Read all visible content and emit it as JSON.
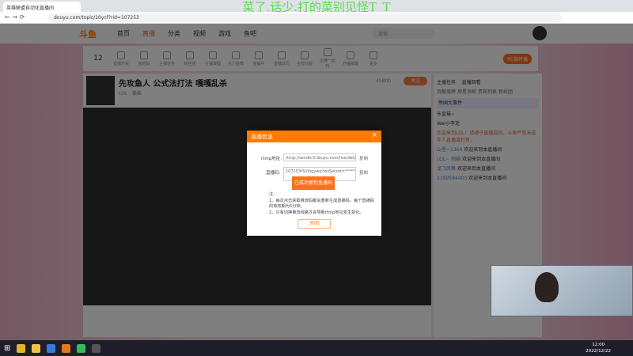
{
  "browser": {
    "tab_title": "英雄联盟自动化直播间",
    "url": "douyu.com/topic/10ycf?rid=107253",
    "overlay_title": "菜了.话少.打的菜别见怪T_T"
  },
  "nav": {
    "logo": "斗鱼",
    "items": [
      "首页",
      "直播",
      "分类",
      "视频",
      "游戏",
      "鱼吧"
    ],
    "active": 1,
    "search_placeholder": "搜索"
  },
  "subnav": {
    "level": "12",
    "items": [
      "直播开关",
      "鱼的码",
      "主播任务",
      "粉丝团",
      "主播课程",
      "大力金牌",
      "鱼抽中",
      "直播日历",
      "全部功能",
      "主播一起玩",
      "开播提醒",
      "更多"
    ],
    "pc_live": "PC端开播"
  },
  "room": {
    "title": "先攻鱼人 公式法打法 嘎嘎乱杀",
    "tag": "LOL · 猫猫",
    "follow": "关注",
    "follow_count": "45800"
  },
  "chat": {
    "tabs": [
      "主播任务",
      "直播回看"
    ],
    "subtabs": [
      "贡献周榜",
      "周星贡献",
      "贵宾列表",
      "粉丝团"
    ],
    "event": "帝国大事件",
    "ranks": [
      "东皇猫~",
      "Wei小李逝"
    ],
    "notice": "欢迎来到LOL！请遵守直播规则，斗鱼严禁未成年人直播或打赏。",
    "messages": [
      {
        "user": "山里~1364",
        "text": "欢迎来到本直播间"
      },
      {
        "user": "LOL~ 雨猫",
        "text": "欢迎来到本直播间"
      },
      {
        "user": "龙飞凤舞",
        "text": "欢迎来到本直播间"
      },
      {
        "user": "2399584403",
        "text": "欢迎来到本直播间"
      }
    ]
  },
  "modal": {
    "title": "直播信息",
    "rtmp_label": "rtmp地址:",
    "rtmp_value": "rtmp://sendtc3.douyu.com/live/delay",
    "code_label": "直播码:",
    "code_value": "107253rSVlogywq?wsSecret=**********",
    "copy": "复制",
    "toast": "已成功复制直播码",
    "notes_title": "注:",
    "note1": "1、每次点击获取推流码都会重新生成直播码，每个直播码的有效期为5分钟。",
    "note2": "2、只有切换推流线路才会导致rtmp地址发生变化。",
    "close": "关闭"
  },
  "taskbar": {
    "time": "12:00",
    "date": "2022/12/22"
  }
}
